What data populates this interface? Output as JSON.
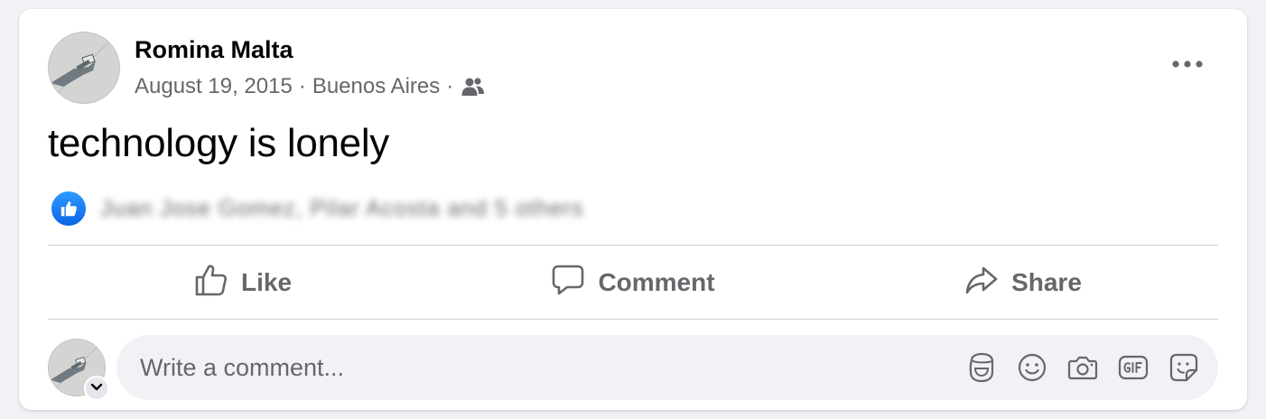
{
  "post": {
    "author_name": "Romina Malta",
    "date": "August 19, 2015",
    "separator": "·",
    "location": "Buenos Aires",
    "audience_icon": "friends-icon",
    "text": "technology is lonely",
    "more_icon": "more-options-icon"
  },
  "reactions": {
    "icon": "like-reaction-icon",
    "summary": "Juan Jose Gomez, Pilar Acosta and 5 others"
  },
  "actions": {
    "like_label": "Like",
    "comment_label": "Comment",
    "share_label": "Share"
  },
  "comment_box": {
    "placeholder": "Write a comment...",
    "tool_icons": [
      "avatar-sticker-icon",
      "emoji-icon",
      "camera-icon",
      "gif-icon",
      "sticker-icon"
    ]
  },
  "colors": {
    "secondary_text": "#65676b",
    "like_blue": "#1877f2",
    "divider": "#ced0d4",
    "input_background": "#f0f2f5"
  }
}
